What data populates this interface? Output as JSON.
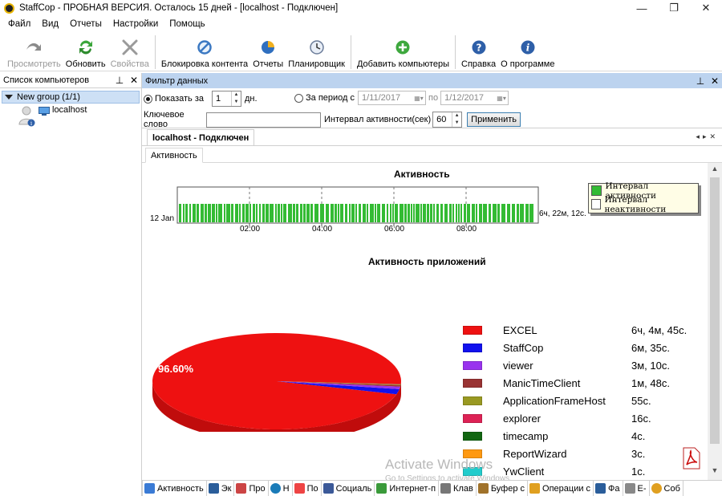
{
  "window": {
    "title": "StaffCop - ПРОБНАЯ ВЕРСИЯ. Осталось 15 дней - [localhost - Подключен]",
    "controls": [
      "—",
      "❐",
      "✕"
    ]
  },
  "menu": [
    "Файл",
    "Вид",
    "Отчеты",
    "Настройки",
    "Помощь"
  ],
  "toolbar": {
    "view": "Просмотреть",
    "refresh": "Обновить",
    "properties": "Свойства",
    "block": "Блокировка контента",
    "reports": "Отчеты",
    "scheduler": "Планировщик",
    "add_computers": "Добавить компьютеры",
    "help": "Справка",
    "about": "О программе"
  },
  "left_panel": {
    "title": "Список компьютеров",
    "group": "New group (1/1)",
    "computer": "localhost"
  },
  "filter": {
    "title": "Фильтр данных",
    "show_for_label": "Показать за",
    "show_for_value": "1",
    "show_for_unit": "дн.",
    "period_label": "За период с",
    "date_from": "1/11/2017",
    "date_to_label": "по",
    "date_to": "1/12/2017",
    "keyword_label": "Ключевое слово",
    "keyword_value": "",
    "interval_label": "Интервал активности(сек)",
    "interval_value": "60",
    "apply": "Применить"
  },
  "doc_tab": "localhost - Подключен",
  "sub_tab": "Активность",
  "activity_chart": {
    "title": "Активность",
    "date_label": "12 Jan",
    "ticks": [
      "02:00",
      "04:00",
      "06:00",
      "08:00"
    ],
    "total": "6ч, 22м, 12с.",
    "legend": [
      {
        "label": "Интервал активности",
        "color": "#33bb33"
      },
      {
        "label": "Интервал неактивности",
        "color": "#ffffff"
      }
    ]
  },
  "chart_data": [
    {
      "type": "timeline",
      "title": "Активность",
      "x_ticks": [
        "02:00",
        "04:00",
        "06:00",
        "08:00"
      ],
      "series": [
        {
          "name": "Интервал активности",
          "color": "#33bb33"
        },
        {
          "name": "Интервал неактивности",
          "color": "#ffffff"
        }
      ]
    },
    {
      "type": "pie",
      "title": "Активность приложений",
      "label": "96.60%",
      "categories": [
        "EXCEL",
        "StaffCop",
        "viewer",
        "ManicTimeClient",
        "ApplicationFrameHost",
        "explorer",
        "timecamp",
        "ReportWizard",
        "YwClient"
      ],
      "durations": [
        "6ч, 4м, 45с.",
        "6м, 35с.",
        "3м, 10с.",
        "1м, 48с.",
        "55с.",
        "16с.",
        "4с.",
        "3с.",
        "1с."
      ],
      "values_seconds": [
        21885,
        395,
        190,
        108,
        55,
        16,
        4,
        3,
        1
      ],
      "colors": [
        "#ee1111",
        "#1111ee",
        "#9933ee",
        "#993333",
        "#999922",
        "#dd2255",
        "#116611",
        "#ff9911",
        "#22cccc"
      ]
    }
  ],
  "apps_chart": {
    "title": "Активность приложений",
    "pie_label": "96.60%"
  },
  "apps": [
    {
      "name": "EXCEL",
      "duration": "6ч, 4м, 45с.",
      "color": "#ee1111"
    },
    {
      "name": "StaffCop",
      "duration": "6м, 35с.",
      "color": "#1111ee"
    },
    {
      "name": "viewer",
      "duration": "3м, 10с.",
      "color": "#9933ee"
    },
    {
      "name": "ManicTimeClient",
      "duration": "1м, 48с.",
      "color": "#993333"
    },
    {
      "name": "ApplicationFrameHost",
      "duration": "55с.",
      "color": "#999922"
    },
    {
      "name": "explorer",
      "duration": "16с.",
      "color": "#dd2255"
    },
    {
      "name": "timecamp",
      "duration": "4с.",
      "color": "#116611"
    },
    {
      "name": "ReportWizard",
      "duration": "3с.",
      "color": "#ff9911"
    },
    {
      "name": "YwClient",
      "duration": "1с.",
      "color": "#22cccc"
    }
  ],
  "watermark": {
    "title": "Activate Windows",
    "sub": "Go to Settings to activate Windows."
  },
  "bottom_tabs": [
    {
      "label": "Активность",
      "icon": "chart-icon"
    },
    {
      "label": "Эк",
      "icon": "monitor-icon"
    },
    {
      "label": "Про",
      "icon": "window-icon"
    },
    {
      "label": "Н",
      "icon": "globe-icon"
    },
    {
      "label": "По",
      "icon": "google-icon"
    },
    {
      "label": "Социаль",
      "icon": "facebook-icon"
    },
    {
      "label": "Интернет-п",
      "icon": "puzzle-icon"
    },
    {
      "label": "Клав",
      "icon": "keyboard-icon"
    },
    {
      "label": "Буфер с",
      "icon": "clipboard-icon"
    },
    {
      "label": "Операции с",
      "icon": "files-icon"
    },
    {
      "label": "Фа",
      "icon": "disk-icon"
    },
    {
      "label": "E-",
      "icon": "mail-icon"
    },
    {
      "label": "Соб",
      "icon": "event-icon"
    }
  ]
}
